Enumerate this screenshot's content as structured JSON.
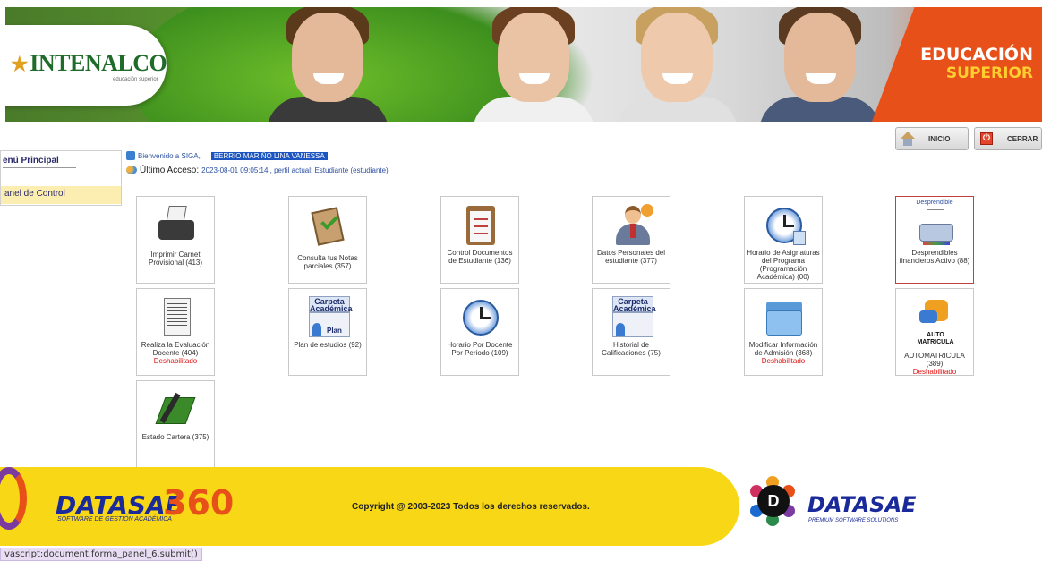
{
  "header": {
    "logo_text": "INTENALCO",
    "logo_subtext": "educación superior",
    "tagline_line1": "EDUCACIÓN",
    "tagline_line2": "SUPERIOR"
  },
  "topbar": {
    "inicio_label": "INICIO",
    "cerrar_label": "CERRAR"
  },
  "menu": {
    "title": "enú Principal",
    "items": [
      "anel de Control"
    ]
  },
  "welcome": {
    "greeting": "Bienvenido a SIGA,",
    "user_name": "BERRIO MARIÑO LINA VANESSA",
    "last_access_label": "Último Acceso:",
    "last_access_value": "2023-08-01 09:05:14 , perfil actual: Estudiante (estudiante)"
  },
  "tiles": [
    {
      "label": "Imprimir Carnet Provisional (413)",
      "icon": "printer-icon"
    },
    {
      "label": "Consulta tus Notas parciales (357)",
      "icon": "clipboard-check-icon"
    },
    {
      "label": "Control Documentos de Estudiante (136)",
      "icon": "clipboard-list-icon"
    },
    {
      "label": "Datos Personales del estudiante (377)",
      "icon": "person-icon"
    },
    {
      "label": "Horario de Asignaturas del Programa (Programación Académica) (00)",
      "icon": "clock-icon"
    },
    {
      "label": "Desprendibles financieros Activo (88)",
      "icon": "printer-icon",
      "top_note": "Desprendible"
    },
    {
      "label": "Realiza la Evaluación Docente (404)",
      "icon": "document-icon",
      "status": "Deshabilitado"
    },
    {
      "label": "Plan de estudios (92)",
      "icon": "folder-card-icon",
      "card_title": "Carpeta Académica",
      "card_sub": "Plan"
    },
    {
      "label": "Horario Por Docente Por Periodo (109)",
      "icon": "clock-icon"
    },
    {
      "label": "Historial de Calificaciones (75)",
      "icon": "folder-card-icon",
      "card_title": "Carpeta Académica"
    },
    {
      "label": "Modificar Información de Admisión (368)",
      "icon": "folder-icon",
      "status": "Deshabilitado"
    },
    {
      "label": "AUTOMATRICULA (389)",
      "icon": "puzzle-icon",
      "icon_text": "AUTO MATRICULA",
      "status": "Deshabilitado"
    },
    {
      "label": "Estado Cartera (375)",
      "icon": "book-icon"
    }
  ],
  "footer": {
    "brand": "DATASAE",
    "brand_number": "360",
    "brand_sub": "SOFTWARE DE GESTIÓN ACADÉMICA",
    "copyright": "Copyright @ 2003-2023 Todos los derechos reservados.",
    "partner_brand": "DATASAE",
    "partner_sub": "PREMIUM SOFTWARE SOLUTIONS"
  },
  "status_bar": "vascript:document.forma_panel_6.submit()",
  "colors": {
    "accent_blue": "#1c55c0",
    "footer_yellow": "#f8d816",
    "brand_orange": "#e8501a",
    "disabled_red": "#e01010"
  }
}
